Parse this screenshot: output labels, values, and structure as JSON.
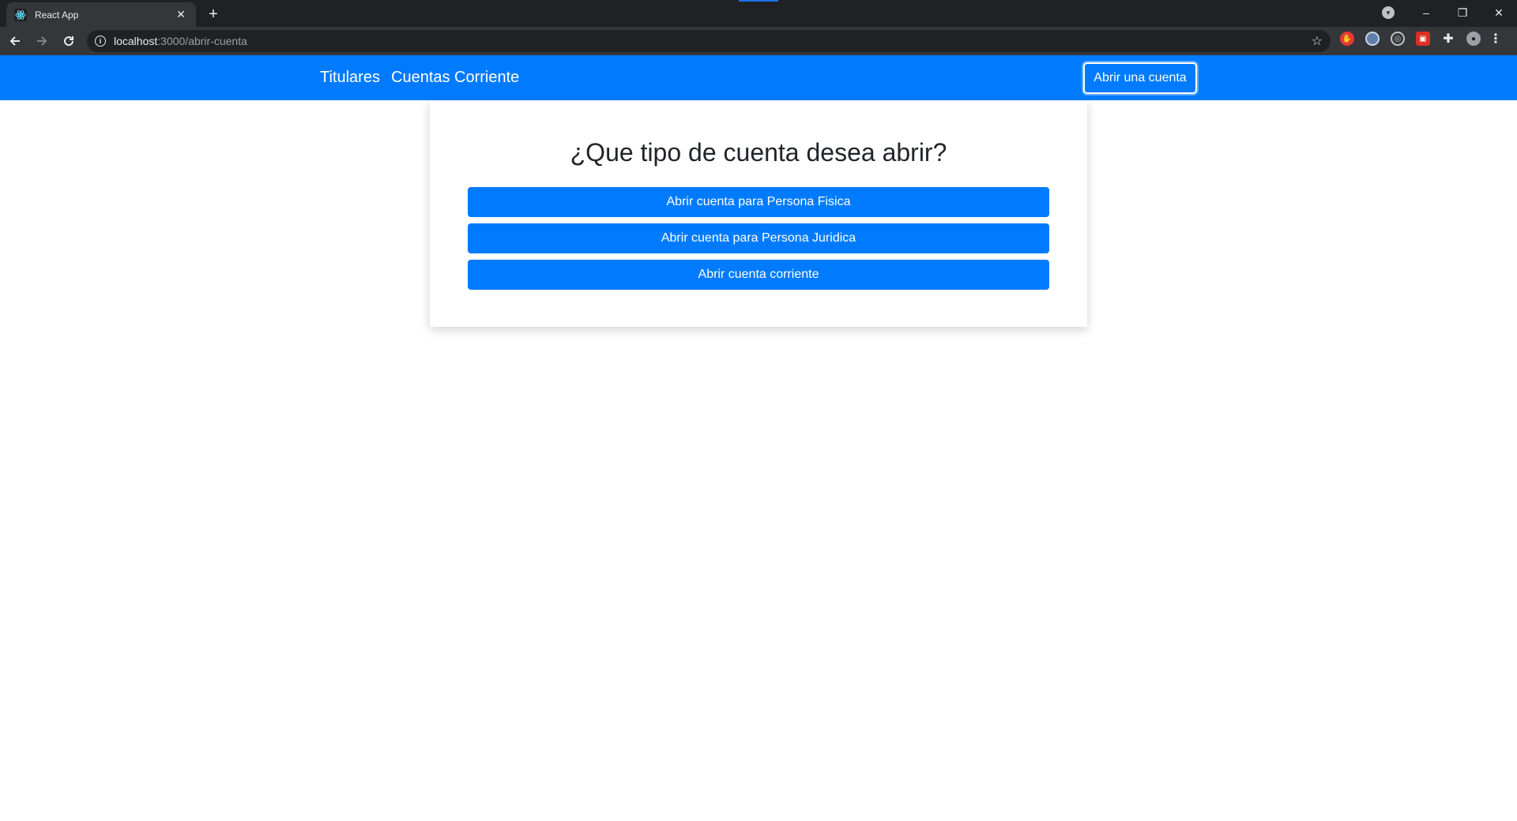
{
  "browser": {
    "tab_title": "React App",
    "tab_close": "✕",
    "new_tab": "+",
    "url_host": "localhost",
    "url_path": ":3000/abrir-cuenta",
    "window_controls": [
      "–",
      "❐",
      "✕"
    ]
  },
  "navbar": {
    "links": [
      "Titulares",
      "Cuentas Corriente"
    ],
    "cta_label": "Abrir una cuenta",
    "color": "#007bff"
  },
  "card": {
    "title": "¿Que tipo de cuenta desea abrir?",
    "buttons": [
      "Abrir cuenta para Persona Fisica",
      "Abrir cuenta para Persona Juridica",
      "Abrir cuenta corriente"
    ]
  },
  "icons": {
    "favicon": "react-icon",
    "back": "arrow-left-icon",
    "forward": "arrow-right-icon",
    "reload": "reload-icon",
    "info": "info-icon",
    "bookmark": "star-icon",
    "extensions": "puzzle-icon",
    "menu": "kebab-menu-icon"
  }
}
